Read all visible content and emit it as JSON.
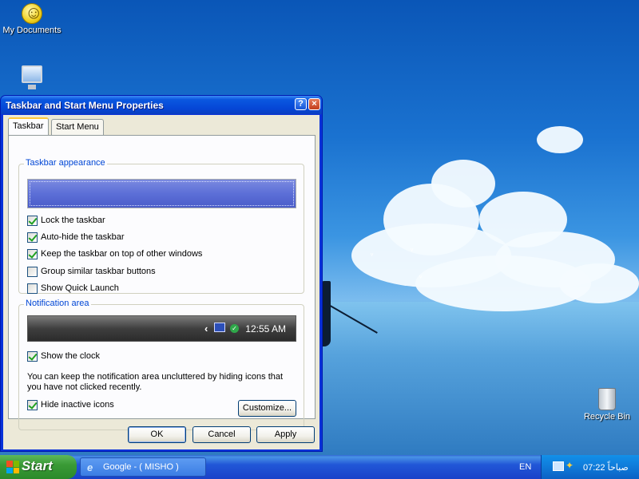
{
  "desktop": {
    "icons": [
      {
        "label": "My Documents",
        "icon": "smiley-documents-icon"
      },
      {
        "label": "",
        "icon": "my-computer-icon"
      },
      {
        "label": "Recycle Bin",
        "icon": "recycle-bin-icon"
      }
    ]
  },
  "dialog": {
    "title": "Taskbar and Start Menu Properties",
    "help_label": "?",
    "close_label": "×",
    "tabs": [
      {
        "label": "Taskbar",
        "active": true
      },
      {
        "label": "Start Menu",
        "active": false
      }
    ],
    "appearance": {
      "group_label": "Taskbar appearance",
      "options": [
        {
          "label": "Lock the taskbar",
          "checked": true
        },
        {
          "label": "Auto-hide the taskbar",
          "checked": true
        },
        {
          "label": "Keep the taskbar on top of other windows",
          "checked": true
        },
        {
          "label": "Group similar taskbar buttons",
          "checked": false
        },
        {
          "label": "Show Quick Launch",
          "checked": false
        }
      ]
    },
    "notification": {
      "group_label": "Notification area",
      "preview_clock": "12:55 AM",
      "preview_chevron": "‹",
      "show_clock": {
        "label": "Show the clock",
        "checked": true
      },
      "note": "You can keep the notification area uncluttered by hiding icons that you have not clicked recently.",
      "hide_inactive": {
        "label": "Hide inactive icons",
        "checked": true
      },
      "customize_label": "Customize..."
    },
    "buttons": {
      "ok": "OK",
      "cancel": "Cancel",
      "apply": "Apply"
    }
  },
  "taskbar": {
    "start_label": "Start",
    "task_button_label": "Google - ( MISHO )",
    "language": "EN",
    "clock": "07:22 صباحاً",
    "colors": {
      "start": "#3a9a36",
      "bar": "#2157d7",
      "tray": "#0f7ad9"
    }
  }
}
